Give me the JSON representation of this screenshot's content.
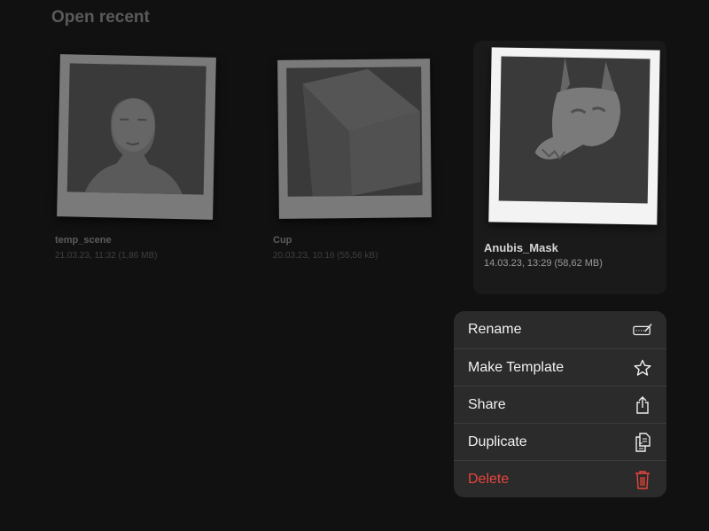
{
  "section": {
    "title": "Open recent"
  },
  "files": [
    {
      "name": "temp_scene",
      "meta": "21.03.23, 11:32 (1,86 MB)"
    },
    {
      "name": "Cup",
      "meta": "20.03.23, 10:16 (55,56 kB)"
    },
    {
      "name": "Anubis_Mask",
      "meta": "14.03.23, 13:29 (58,62 MB)",
      "selected": true
    }
  ],
  "context_menu": {
    "items": [
      {
        "label": "Rename",
        "icon": "rename-icon"
      },
      {
        "label": "Make Template",
        "icon": "star-icon"
      },
      {
        "label": "Share",
        "icon": "share-icon"
      },
      {
        "label": "Duplicate",
        "icon": "duplicate-icon"
      },
      {
        "label": "Delete",
        "icon": "trash-icon",
        "destructive": true
      }
    ]
  },
  "colors": {
    "background": "#111111",
    "menu": "#2b2b2b",
    "destructive": "#e8453c"
  }
}
